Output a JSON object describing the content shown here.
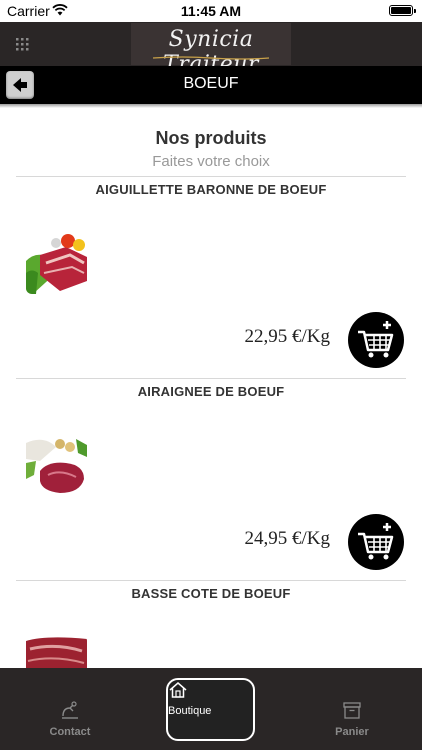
{
  "status_bar": {
    "carrier": "Carrier",
    "time": "11:45 AM"
  },
  "header": {
    "logo_text": "Synicia Traiteur",
    "menu_icon": "grid-icon"
  },
  "nav": {
    "title": "BOEUF",
    "back_icon": "back-arrow-icon"
  },
  "main": {
    "heading": "Nos produits",
    "subheading": "Faites votre choix",
    "products": [
      {
        "name": "AIGUILLETTE BARONNE DE BOEUF",
        "price": "22,95 €/Kg"
      },
      {
        "name": "AIRAIGNEE DE BOEUF",
        "price": "24,95 €/Kg"
      },
      {
        "name": "BASSE COTE DE BOEUF",
        "price": ""
      }
    ]
  },
  "tabbar": {
    "tabs": [
      {
        "label": "Contact",
        "icon": "contact-icon"
      },
      {
        "label": "Boutique",
        "icon": "home-icon",
        "active": true
      },
      {
        "label": "Panier",
        "icon": "box-icon"
      }
    ]
  },
  "colors": {
    "bar_bg": "#2a2626",
    "nav_bg": "#000000",
    "accent_gold": "#c9a24a"
  }
}
